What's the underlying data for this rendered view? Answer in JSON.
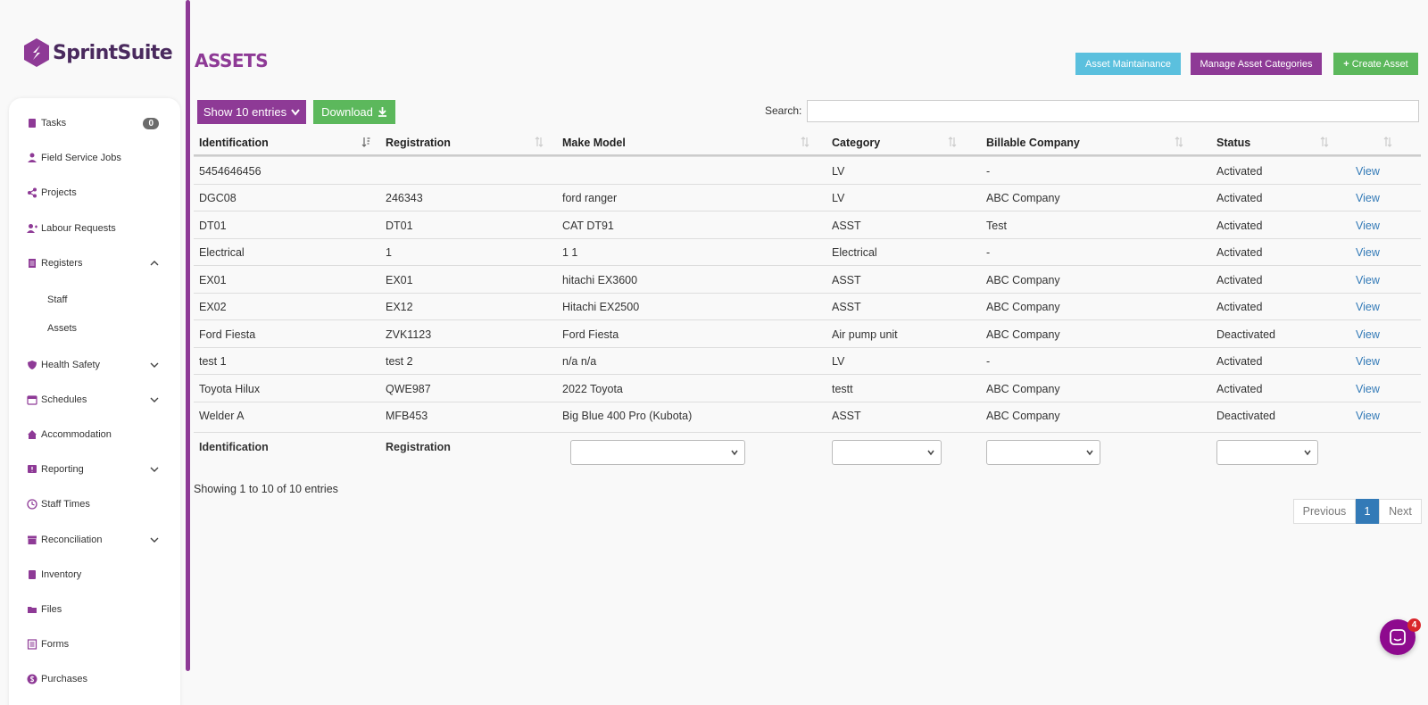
{
  "brand": {
    "name": "SprintSuite",
    "color": "#8e3a96"
  },
  "sidebar": {
    "items": [
      {
        "label": "Tasks",
        "icon": "clipboard-icon",
        "badge": "0"
      },
      {
        "label": "Field Service Jobs",
        "icon": "worker-icon"
      },
      {
        "label": "Projects",
        "icon": "share-icon"
      },
      {
        "label": "Labour Requests",
        "icon": "user-plus-icon"
      },
      {
        "label": "Registers",
        "icon": "document-icon",
        "expanded": true
      },
      {
        "label": "Staff",
        "sub": true
      },
      {
        "label": "Assets",
        "sub": true
      },
      {
        "label": "Health Safety",
        "icon": "shield-icon"
      },
      {
        "label": "Schedules",
        "icon": "calendar-icon"
      },
      {
        "label": "Accommodation",
        "icon": "home-icon"
      },
      {
        "label": "Reporting",
        "icon": "alert-icon"
      },
      {
        "label": "Staff Times",
        "icon": "clock-icon"
      },
      {
        "label": "Reconciliation",
        "icon": "archive-icon"
      },
      {
        "label": "Inventory",
        "icon": "clipboard-icon"
      },
      {
        "label": "Files",
        "icon": "folder-icon"
      },
      {
        "label": "Forms",
        "icon": "list-icon"
      },
      {
        "label": "Purchases",
        "icon": "dollar-icon"
      }
    ]
  },
  "page": {
    "title": "ASSETS",
    "actions": {
      "maintenance": "Asset Maintainance",
      "categories": "Manage Asset Categories",
      "create": "Create Asset"
    },
    "toolbar": {
      "show_entries": "Show 10 entries",
      "download": "Download",
      "search_label": "Search:",
      "search_value": ""
    }
  },
  "table": {
    "headers": [
      "Identification",
      "Registration",
      "Make Model",
      "Category",
      "Billable Company",
      "Status",
      ""
    ],
    "rows": [
      [
        "5454646456",
        "",
        "",
        "LV",
        "-",
        "Activated",
        "View"
      ],
      [
        "DGC08",
        "246343",
        "ford ranger",
        "LV",
        "ABC Company",
        "Activated",
        "View"
      ],
      [
        "DT01",
        "DT01",
        "CAT DT91",
        "ASST",
        "Test",
        "Activated",
        "View"
      ],
      [
        "Electrical",
        "1",
        "1 1",
        "Electrical",
        "-",
        "Activated",
        "View"
      ],
      [
        "EX01",
        "EX01",
        "hitachi EX3600",
        "ASST",
        "ABC Company",
        "Activated",
        "View"
      ],
      [
        "EX02",
        "EX12",
        "Hitachi EX2500",
        "ASST",
        "ABC Company",
        "Activated",
        "View"
      ],
      [
        "Ford Fiesta",
        "ZVK1123",
        "Ford Fiesta",
        "Air pump unit",
        "ABC Company",
        "Deactivated",
        "View"
      ],
      [
        "test 1",
        "test 2",
        "n/a n/a",
        "LV",
        "-",
        "Activated",
        "View"
      ],
      [
        "Toyota Hilux",
        "QWE987",
        "2022 Toyota",
        "testt",
        "ABC Company",
        "Activated",
        "View"
      ],
      [
        "Welder A",
        "MFB453",
        "Big Blue 400 Pro (Kubota)",
        "ASST",
        "ABC Company",
        "Deactivated",
        "View"
      ]
    ],
    "footer": {
      "identification": "Identification",
      "registration": "Registration"
    }
  },
  "info": "Showing 1 to 10 of 10 entries",
  "pager": {
    "previous": "Previous",
    "current": "1",
    "next": "Next"
  },
  "chat": {
    "unread": "4"
  }
}
